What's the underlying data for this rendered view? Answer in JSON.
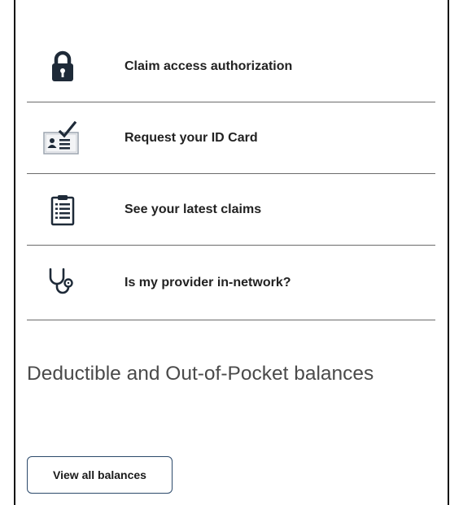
{
  "links": [
    {
      "label": "Claim access authorization",
      "icon": "lock-icon"
    },
    {
      "label": "Request your ID Card",
      "icon": "id-card-icon"
    },
    {
      "label": "See your latest claims",
      "icon": "clipboard-icon"
    },
    {
      "label": "Is my provider in-network?",
      "icon": "stethoscope-icon"
    }
  ],
  "balances": {
    "heading": "Deductible and Out-of-Pocket balances",
    "button_label": "View all balances"
  },
  "colors": {
    "icon": "#1e2a38",
    "divider": "#6b6b6b",
    "button_border": "#2c4a6b",
    "heading_text": "#4a4a4a"
  }
}
